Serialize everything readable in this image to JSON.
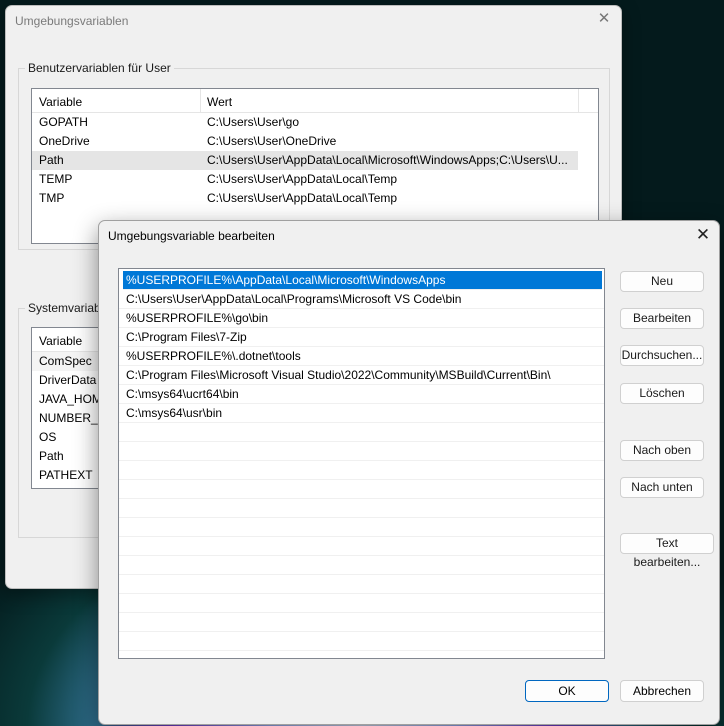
{
  "background_window": {
    "title": "Umgebungsvariablen",
    "close_glyph": "✕",
    "user_group": {
      "label": "Benutzervariablen für User",
      "columns": [
        "Variable",
        "Wert"
      ],
      "rows": [
        {
          "variable": "GOPATH",
          "value": "C:\\Users\\User\\go"
        },
        {
          "variable": "OneDrive",
          "value": "C:\\Users\\User\\OneDrive"
        },
        {
          "variable": "Path",
          "value": "C:\\Users\\User\\AppData\\Local\\Microsoft\\WindowsApps;C:\\Users\\U..."
        },
        {
          "variable": "TEMP",
          "value": "C:\\Users\\User\\AppData\\Local\\Temp"
        },
        {
          "variable": "TMP",
          "value": "C:\\Users\\User\\AppData\\Local\\Temp"
        }
      ],
      "selected_row": "Path"
    },
    "system_group": {
      "label": "Systemvariablen",
      "label_visible": "Systemvariabl",
      "columns": [
        "Variable"
      ],
      "rows": [
        "ComSpec",
        "DriverData",
        "JAVA_HOME",
        "NUMBER_OF_PROCESSORS",
        "OS",
        "Path",
        "PATHEXT"
      ],
      "rows_visible": [
        "ComSpec",
        "DriverData",
        "JAVA_HOM",
        "NUMBER_O",
        "OS",
        "Path",
        "PATHEXT"
      ]
    }
  },
  "dialog": {
    "title": "Umgebungsvariable bearbeiten",
    "close_glyph": "✕",
    "paths": [
      "%USERPROFILE%\\AppData\\Local\\Microsoft\\WindowsApps",
      "C:\\Users\\User\\AppData\\Local\\Programs\\Microsoft VS Code\\bin",
      "%USERPROFILE%\\go\\bin",
      "C:\\Program Files\\7-Zip",
      "%USERPROFILE%\\.dotnet\\tools",
      "C:\\Program Files\\Microsoft Visual Studio\\2022\\Community\\MSBuild\\Current\\Bin\\",
      "C:\\msys64\\ucrt64\\bin",
      "C:\\msys64\\usr\\bin"
    ],
    "selected_index": 0,
    "buttons": {
      "new": "Neu",
      "edit": "Bearbeiten",
      "browse": "Durchsuchen...",
      "delete": "Löschen",
      "move_up": "Nach oben",
      "move_down": "Nach unten",
      "edit_text": "Text bearbeiten...",
      "ok": "OK",
      "cancel": "Abbrechen"
    },
    "accent_color": "#0078d7"
  }
}
